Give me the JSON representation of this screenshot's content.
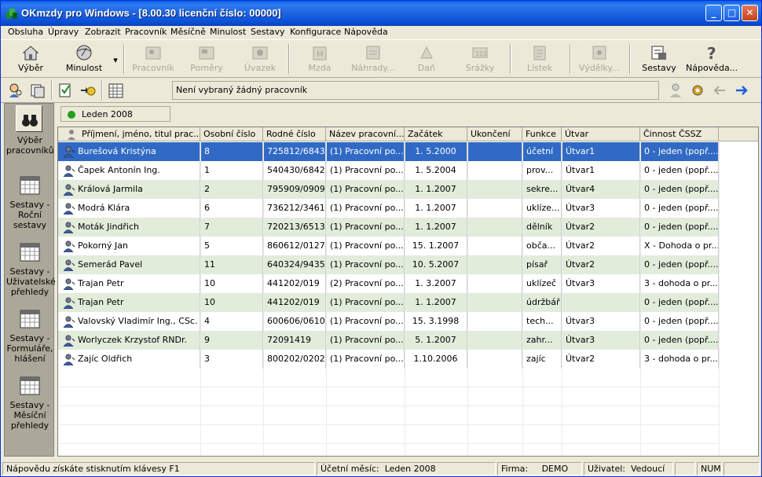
{
  "window": {
    "title": "OKmzdy pro Windows - [8.00.30 licenční číslo: 00000]"
  },
  "menu": [
    "Obsluha",
    "Úpravy",
    "Zobrazit",
    "Pracovník",
    "Měsíčně",
    "Minulost",
    "Sestavy",
    "Konfigurace",
    "Nápověda"
  ],
  "toolbar": {
    "vyber": "Výběr",
    "minulost": "Minulost",
    "pracovnik": "Pracovník",
    "pomery": "Poměry",
    "uvazek": "Úvazek",
    "mzda": "Mzda",
    "nahrady": "Náhrady...",
    "dan": "Daň",
    "srazky": "Srážky",
    "listek": "Lístek",
    "vydelky": "Výdělky...",
    "sestavy": "Sestavy",
    "napoveda": "Nápověda..."
  },
  "status_info": "Není vybraný žádný pracovník",
  "sidebar": {
    "vyber": "Výběr pracovníků",
    "rocni": "Sestavy - Roční sestavy",
    "uzivatelske": "Sestavy - Uživatelské přehledy",
    "formulare": "Sestavy - Formuláře, hlášení",
    "mesicni": "Sestavy - Měsíční přehledy"
  },
  "period": "Leden 2008",
  "columns": [
    "Příjmení, jméno, titul prac...",
    "Osobní číslo",
    "Rodné číslo",
    "Název pracovní...",
    "Začátek",
    "Ukončení",
    "Funkce",
    "Útvar",
    "Činnost ČSSZ"
  ],
  "rows": [
    {
      "name": "Burešová Kristýna",
      "os": "8",
      "rc": "725812/6843",
      "nazev": "(1) Pracovní po...",
      "zac": "1. 5.2000",
      "uk": "",
      "funkce": "účetní",
      "utvar": "Útvar1",
      "cinnost": "0 - jeden (popř...."
    },
    {
      "name": "Čapek Antonín Ing.",
      "os": "1",
      "rc": "540430/6842",
      "nazev": "(1) Pracovní po...",
      "zac": "1. 5.2004",
      "uk": "",
      "funkce": "prov...",
      "utvar": "Útvar1",
      "cinnost": "0 - jeden (popř...."
    },
    {
      "name": "Králová Jarmila",
      "os": "2",
      "rc": "795909/0909",
      "nazev": "(1) Pracovní po...",
      "zac": "1. 1.2007",
      "uk": "",
      "funkce": "sekre...",
      "utvar": "Útvar4",
      "cinnost": "0 - jeden (popř...."
    },
    {
      "name": "Modrá Klára",
      "os": "6",
      "rc": "736212/3461",
      "nazev": "(1) Pracovní po...",
      "zac": "1. 1.2007",
      "uk": "",
      "funkce": "uklíze...",
      "utvar": "Útvar3",
      "cinnost": "0 - jeden (popř...."
    },
    {
      "name": "Moták Jindřich",
      "os": "7",
      "rc": "720213/6513",
      "nazev": "(1) Pracovní po...",
      "zac": "1. 1.2007",
      "uk": "",
      "funkce": "dělník",
      "utvar": "Útvar2",
      "cinnost": "0 - jeden (popř...."
    },
    {
      "name": "Pokorný Jan",
      "os": "5",
      "rc": "860612/0127",
      "nazev": "(1) Pracovní po...",
      "zac": "15. 1.2007",
      "uk": "",
      "funkce": "obča...",
      "utvar": "Útvar2",
      "cinnost": "X - Dohoda o pr..."
    },
    {
      "name": "Semerád Pavel",
      "os": "11",
      "rc": "640324/9435",
      "nazev": "(1) Pracovní po...",
      "zac": "10. 5.2007",
      "uk": "",
      "funkce": "písař",
      "utvar": "Útvar2",
      "cinnost": "0 - jeden (popř...."
    },
    {
      "name": "Trajan Petr",
      "os": "10",
      "rc": "441202/019",
      "nazev": "(2) Pracovní po...",
      "zac": "1. 3.2007",
      "uk": "",
      "funkce": "uklízeč",
      "utvar": "Útvar3",
      "cinnost": "3 - dohoda o pr..."
    },
    {
      "name": "Trajan Petr",
      "os": "10",
      "rc": "441202/019",
      "nazev": "(1) Pracovní po...",
      "zac": "1. 1.2007",
      "uk": "",
      "funkce": "údržbář",
      "utvar": "",
      "cinnost": "0 - jeden (popř...."
    },
    {
      "name": "Valovský Vladimír Ing., CSc.",
      "os": "4",
      "rc": "600606/0610",
      "nazev": "(1) Pracovní po...",
      "zac": "15. 3.1998",
      "uk": "",
      "funkce": "tech...",
      "utvar": "Útvar3",
      "cinnost": "0 - jeden (popř...."
    },
    {
      "name": "Worlyczek Krzystof RNDr.",
      "os": "9",
      "rc": "72091419",
      "nazev": "(1) Pracovní po...",
      "zac": "5. 1.2007",
      "uk": "",
      "funkce": "zahr...",
      "utvar": "Útvar3",
      "cinnost": "0 - jeden (popř...."
    },
    {
      "name": "Zajíc Oldřich",
      "os": "3",
      "rc": "800202/0202",
      "nazev": "(1) Pracovní po...",
      "zac": "1.10.2006",
      "uk": "",
      "funkce": "zajíc",
      "utvar": "Útvar2",
      "cinnost": "3 - dohoda o pr..."
    }
  ],
  "statusbar": {
    "help": "Nápovědu získáte stisknutím klávesy F1",
    "month_label": "Účetní měsíc:",
    "month": "Leden 2008",
    "firm_label": "Firma:",
    "firm": "DEMO",
    "user_label": "Uživatel:",
    "user": "Vedoucí",
    "num": "NUM"
  },
  "colors": {
    "titlebar": "#0a5fe8",
    "selection": "#316ac5",
    "alt_row": "#e1ecdb",
    "face": "#ece9d8"
  }
}
